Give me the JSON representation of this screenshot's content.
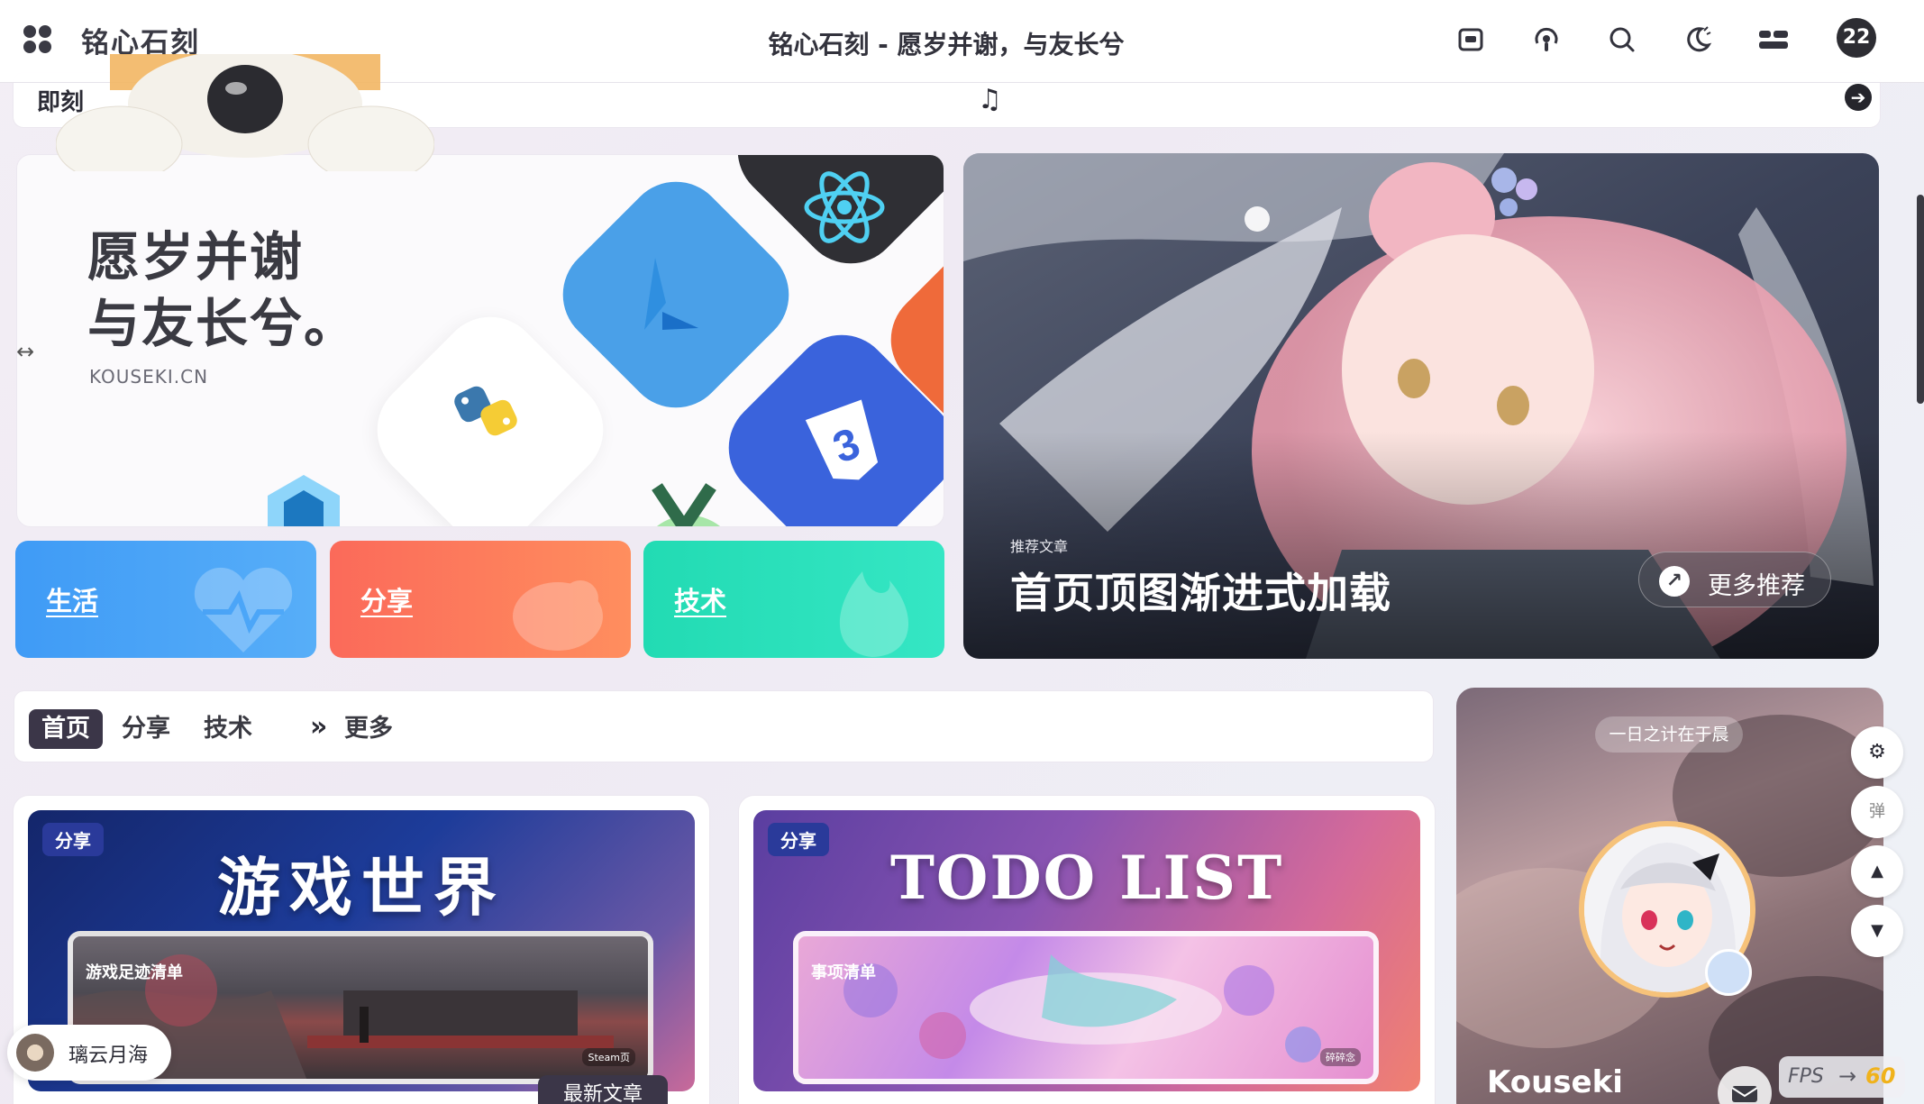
{
  "navbar": {
    "site_name": "铭心石刻",
    "page_heading": "铭心石刻 - 愿岁并谢，与友长兮",
    "avatar_count": "22",
    "icons": [
      "menu-icon",
      "random-post-icon",
      "podcast-icon",
      "search-icon",
      "theme-toggle-icon",
      "sidebar-toggle-icon"
    ]
  },
  "notice": {
    "label": "即刻",
    "music_symbol": "♫",
    "arrow_symbol": "➔"
  },
  "hero": {
    "title_line1": "愿岁并谢",
    "title_line2": "与友长兮。",
    "subtitle": "KOUSEKI.CN",
    "drag_symbol": "↔"
  },
  "categories": [
    {
      "label": "生活",
      "color": "#3f9bf6"
    },
    {
      "label": "分享",
      "color": "#fb6f5a"
    },
    {
      "label": "技术",
      "color": "#26dcb5"
    }
  ],
  "feature": {
    "small_label": "推荐文章",
    "title": "首页顶图渐进式加载",
    "more_label": "更多推荐"
  },
  "tabs": {
    "items": [
      "首页",
      "分享",
      "技术"
    ],
    "arrows": "»",
    "more": "更多"
  },
  "posts": [
    {
      "badge": "分享",
      "cover_title": "游戏世界",
      "shot_label": "游戏足迹清单",
      "shot_tag": "Steam页"
    },
    {
      "badge": "分享",
      "cover_title": "TODO LIST",
      "shot_label": "事项清单",
      "shot_tag": "碎碎念"
    }
  ],
  "latest_label": "最新文章",
  "profile": {
    "motto": "一日之计在于晨",
    "name": "Kouseki"
  },
  "float_buttons": {
    "settings": "⚙",
    "danmaku": "弹",
    "up": "▲",
    "down": "▼"
  },
  "music": {
    "name": "璃云月海"
  },
  "fps": {
    "label": "FPS",
    "arrow": "→",
    "value": "60"
  },
  "colors": {
    "accent": "#3b3648",
    "fps": "#f0b21b"
  }
}
